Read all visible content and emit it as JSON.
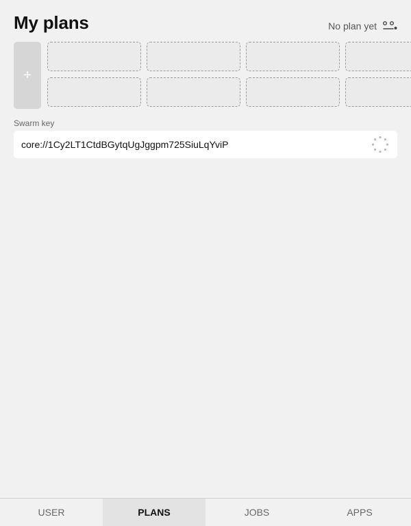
{
  "header": {
    "title": "My plans",
    "status_text": "No plan yet",
    "status_icon": "no-plan-face-icon"
  },
  "plans": {
    "add_label": "+",
    "add_icon": "plus-icon",
    "empty_slots_visible": 8
  },
  "swarm_key": {
    "label": "Swarm key",
    "value": "core://1Cy2LT1CtdBGytqUgJggpm725SiuLqYviP",
    "loading_icon": "loading-spinner-icon"
  },
  "tabs": [
    {
      "label": "USER",
      "active": false
    },
    {
      "label": "PLANS",
      "active": true
    },
    {
      "label": "JOBS",
      "active": false
    },
    {
      "label": "APPS",
      "active": false
    }
  ],
  "colors": {
    "background": "#f1f1f1",
    "active_tab": "#e3e3e3",
    "add_button": "#d6d6d6"
  }
}
